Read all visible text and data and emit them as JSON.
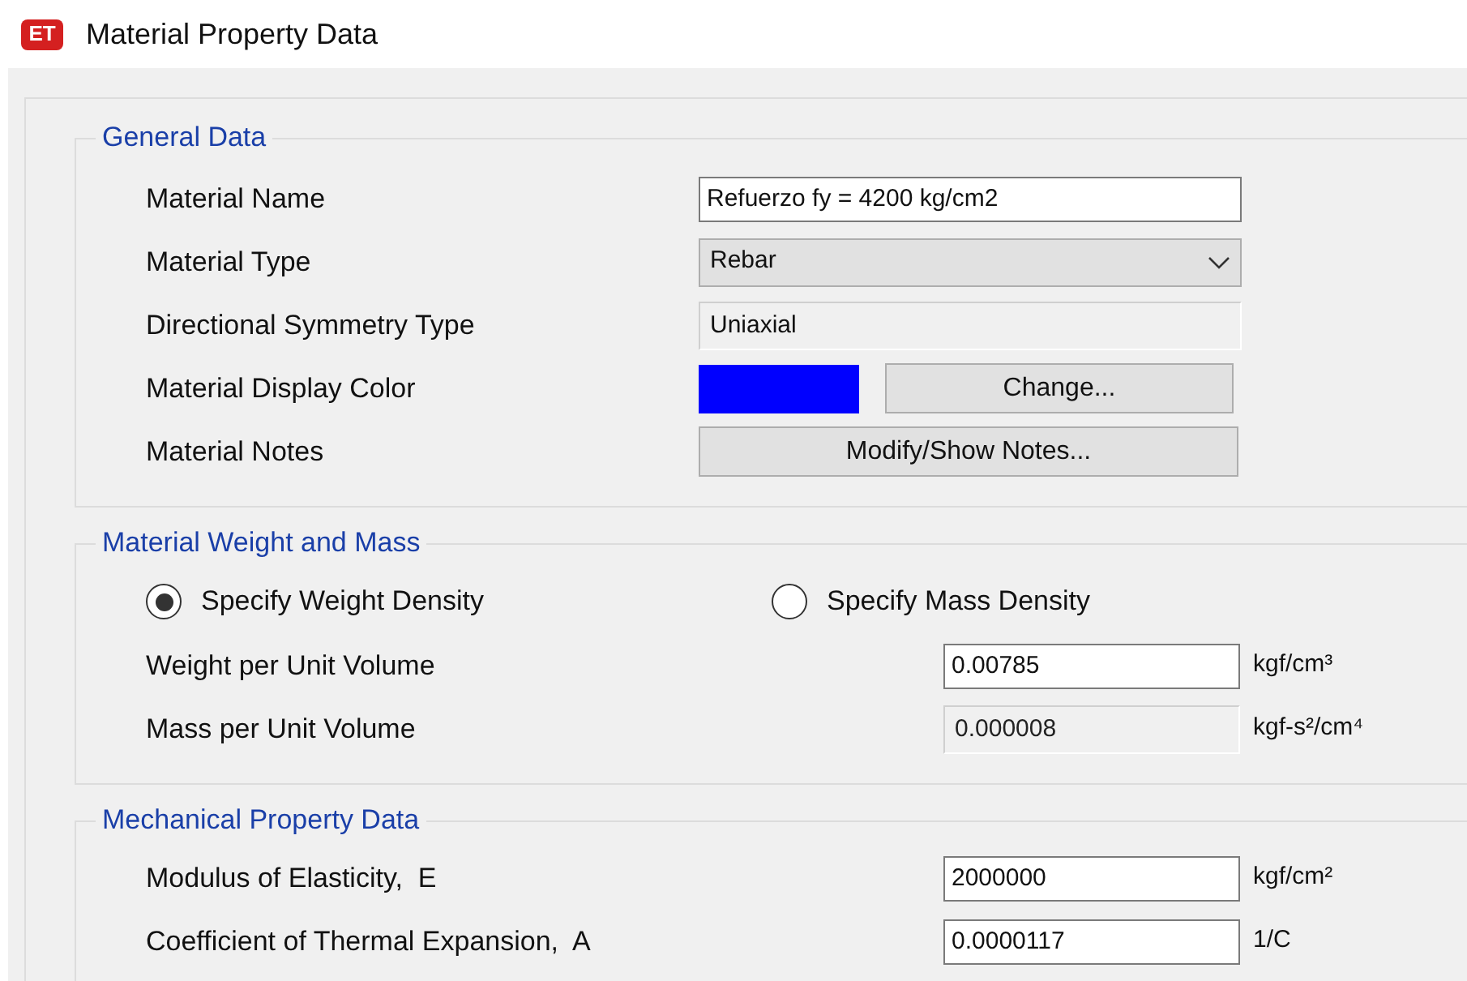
{
  "window": {
    "title": "Material Property Data",
    "app_icon_text": "ET"
  },
  "general_data": {
    "title": "General Data",
    "rows": [
      {
        "kind": "text",
        "label": "Material Name",
        "value": "Refuerzo fy = 4200 kg/cm2"
      },
      {
        "kind": "dropdown",
        "label": "Material Type",
        "value": "Rebar"
      },
      {
        "kind": "readonly",
        "label": "Directional Symmetry Type",
        "value": "Uniaxial"
      },
      {
        "kind": "color",
        "label": "Material Display Color",
        "color": "#0000ff",
        "button": "Change..."
      },
      {
        "kind": "button",
        "label": "Material Notes",
        "button": "Modify/Show Notes..."
      }
    ]
  },
  "weight_and_mass": {
    "title": "Material Weight and Mass",
    "radios": [
      {
        "label": "Specify Weight Density",
        "selected": true
      },
      {
        "label": "Specify Mass Density",
        "selected": false
      }
    ],
    "rows": [
      {
        "label": "Weight per Unit Volume",
        "value": "0.00785",
        "unit": "kgf/cm³",
        "disabled": false
      },
      {
        "label": "Mass per Unit Volume",
        "value": "0.000008",
        "unit": "kgf-s²/cm⁴",
        "disabled": true
      }
    ]
  },
  "mechanical": {
    "title": "Mechanical Property Data",
    "rows": [
      {
        "label": "Modulus of Elasticity,  E",
        "value": "2000000",
        "unit": "kgf/cm²",
        "disabled": false
      },
      {
        "label": "Coefficient of Thermal Expansion,  A",
        "value": "0.0000117",
        "unit": "1/C",
        "disabled": false
      }
    ]
  }
}
